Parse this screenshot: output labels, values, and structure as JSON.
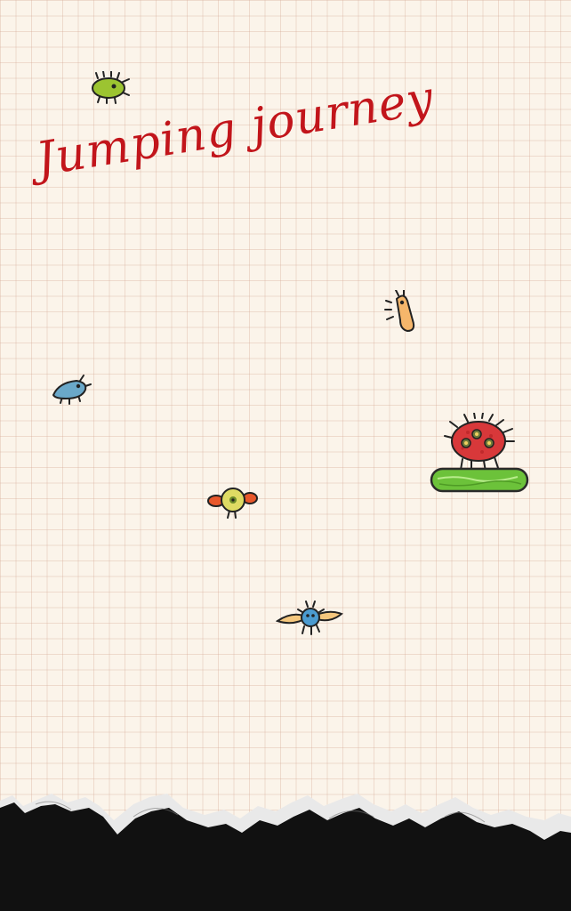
{
  "game": {
    "title": "Jumping journey"
  },
  "colors": {
    "title": "#c2151b",
    "paper": "#fbf4ea",
    "grid": "#d6a896",
    "platform": "#6cc23a",
    "player": "#d8383a",
    "tear": "#111111"
  },
  "sprites": {
    "green_bug": "green-bug-icon",
    "orange_worm": "orange-worm-icon",
    "blue_bug": "blue-bug-icon",
    "winged_eye": "winged-eyeball-icon",
    "propeller_bug": "propeller-bug-icon",
    "red_monster": "red-monster-icon",
    "platform": "green-platform"
  }
}
